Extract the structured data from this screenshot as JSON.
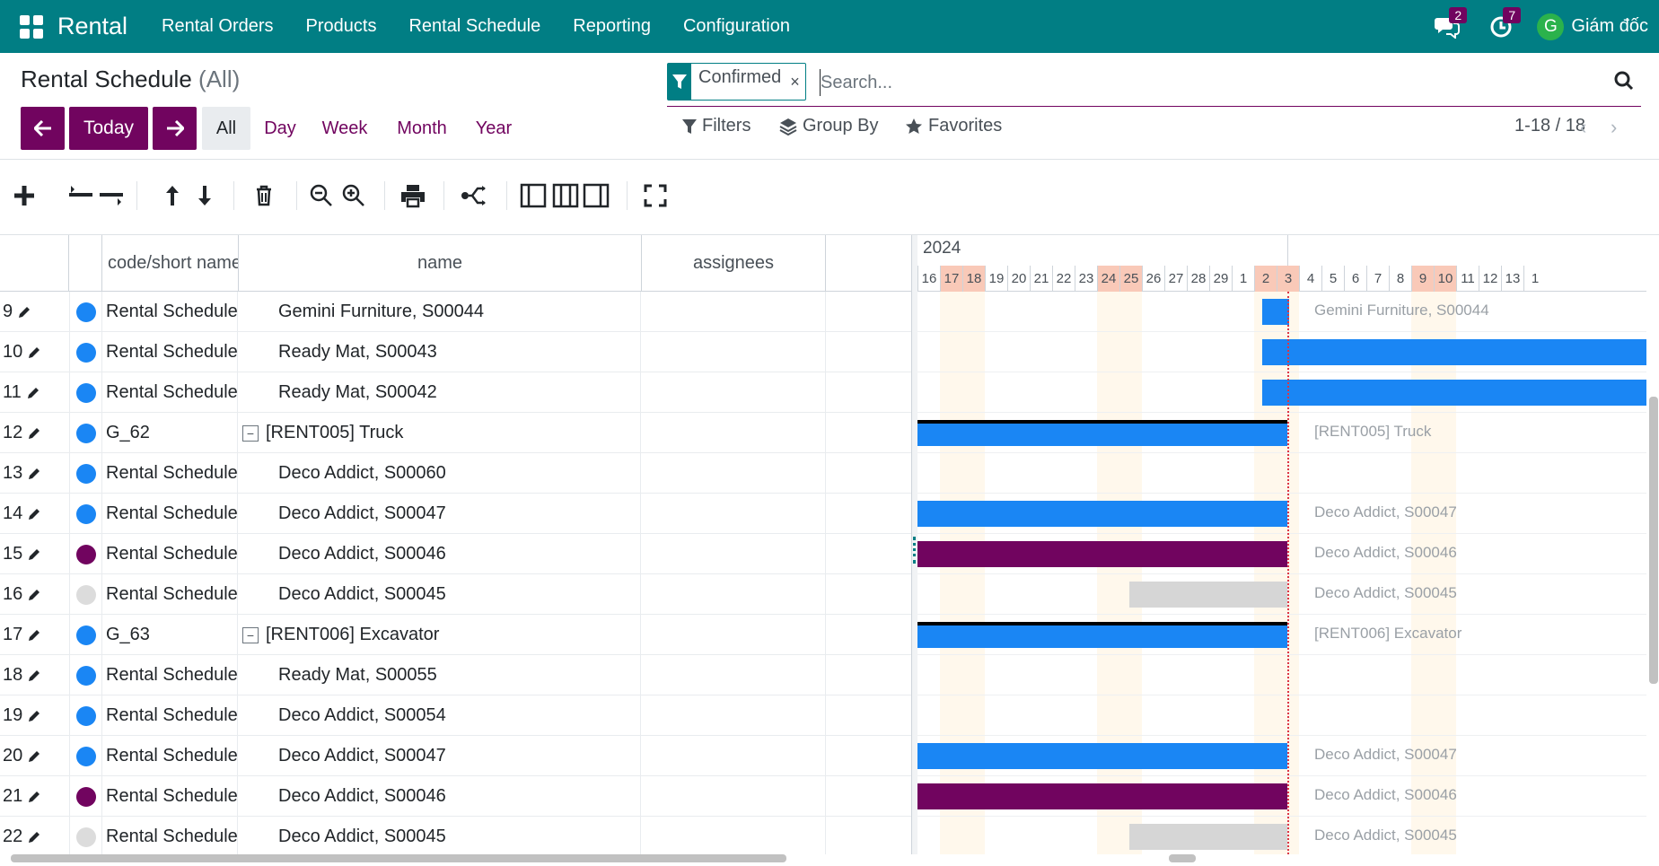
{
  "nav": {
    "brand": "Rental",
    "menu": [
      "Rental Orders",
      "Products",
      "Rental Schedule",
      "Reporting",
      "Configuration"
    ],
    "messages_count": "2",
    "activities_count": "7",
    "avatar_letter": "G",
    "user_name": "Giám đốc"
  },
  "control_panel": {
    "title": "Rental Schedule",
    "title_suffix": "(All)",
    "facet": "Confirmed",
    "search_placeholder": "Search...",
    "today_label": "Today",
    "scales": [
      "All",
      "Day",
      "Week",
      "Month",
      "Year"
    ],
    "active_scale": "All",
    "filters_label": "Filters",
    "groupby_label": "Group By",
    "favorites_label": "Favorites",
    "pager": "1-18 / 18"
  },
  "grid": {
    "columns": [
      "code/short name",
      "name",
      "assignees"
    ],
    "rows": [
      {
        "num": "9",
        "color": "#1a86f4",
        "code": "Rental Schedule",
        "name": "Gemini Furniture, S00044",
        "group": false
      },
      {
        "num": "10",
        "color": "#1a86f4",
        "code": "Rental Schedule",
        "name": "Ready Mat, S00043",
        "group": false
      },
      {
        "num": "11",
        "color": "#1a86f4",
        "code": "Rental Schedule",
        "name": "Ready Mat, S00042",
        "group": false
      },
      {
        "num": "12",
        "color": "#1a86f4",
        "code": "G_62",
        "name": "[RENT005] Truck",
        "group": true
      },
      {
        "num": "13",
        "color": "#1a86f4",
        "code": "Rental Schedule",
        "name": "Deco Addict, S00060",
        "group": false
      },
      {
        "num": "14",
        "color": "#1a86f4",
        "code": "Rental Schedule",
        "name": "Deco Addict, S00047",
        "group": false
      },
      {
        "num": "15",
        "color": "#71045f",
        "code": "Rental Schedule",
        "name": "Deco Addict, S00046",
        "group": false
      },
      {
        "num": "16",
        "color": "#dcdcdc",
        "code": "Rental Schedule",
        "name": "Deco Addict, S00045",
        "group": false
      },
      {
        "num": "17",
        "color": "#1a86f4",
        "code": "G_63",
        "name": "[RENT006] Excavator",
        "group": true
      },
      {
        "num": "18",
        "color": "#1a86f4",
        "code": "Rental Schedule",
        "name": "Ready Mat, S00055",
        "group": false
      },
      {
        "num": "19",
        "color": "#1a86f4",
        "code": "Rental Schedule",
        "name": "Deco Addict, S00054",
        "group": false
      },
      {
        "num": "20",
        "color": "#1a86f4",
        "code": "Rental Schedule",
        "name": "Deco Addict, S00047",
        "group": false
      },
      {
        "num": "21",
        "color": "#71045f",
        "code": "Rental Schedule",
        "name": "Deco Addict, S00046",
        "group": false
      },
      {
        "num": "22",
        "color": "#dcdcdc",
        "code": "Rental Schedule",
        "name": "Deco Addict, S00045",
        "group": false
      }
    ]
  },
  "gantt": {
    "year": "2024",
    "days": [
      "16",
      "17",
      "18",
      "19",
      "20",
      "21",
      "22",
      "23",
      "24",
      "25",
      "26",
      "27",
      "28",
      "29",
      "1",
      "2",
      "3",
      "4",
      "5",
      "6",
      "7",
      "8",
      "9",
      "10",
      "11",
      "12",
      "13",
      "1"
    ],
    "holidays": [
      "17",
      "18",
      "24",
      "25",
      "2",
      "3",
      "9",
      "10"
    ],
    "labels": {
      "r9": "Gemini Furniture, S00044",
      "r12": "[RENT005] Truck",
      "r14": "Deco Addict, S00047",
      "r15": "Deco Addict, S00046",
      "r16": "Deco Addict, S00045",
      "r17": "[RENT006] Excavator",
      "r20": "Deco Addict, S00047",
      "r21": "Deco Addict, S00046",
      "r22": "Deco Addict, S00045"
    }
  },
  "colors": {
    "navbar": "#017e84",
    "primary": "#71045f",
    "bar_blue": "#1a86f4",
    "bar_purple": "#71045f",
    "bar_grey": "#d6d6d6",
    "holiday": "#f9c9b8",
    "weekend_shade": "#fff8ec"
  }
}
